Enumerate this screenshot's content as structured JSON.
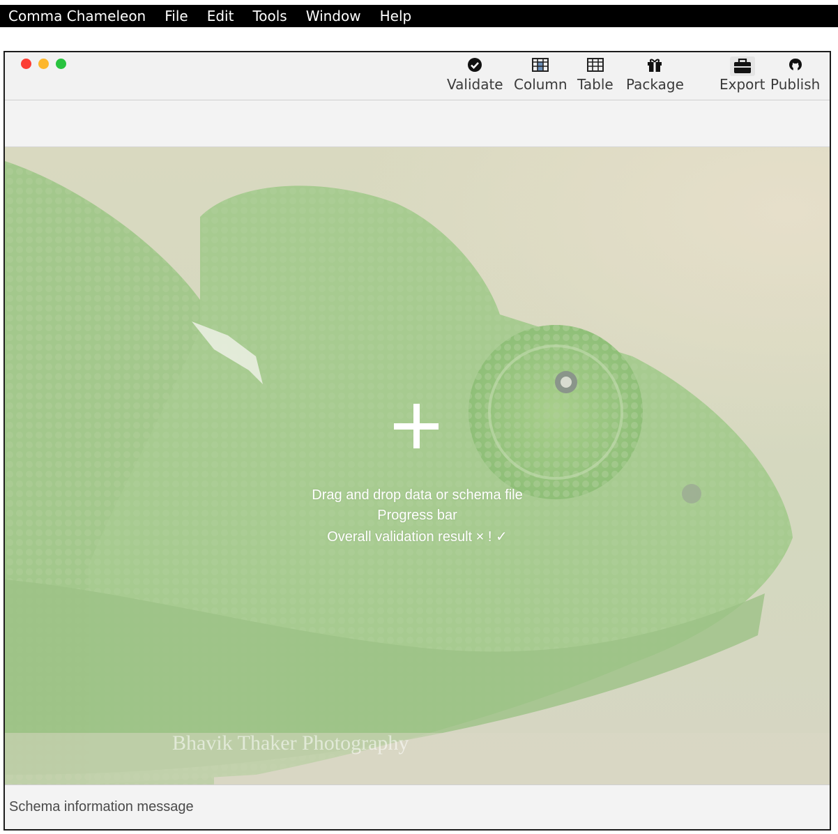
{
  "menubar": {
    "items": [
      "Comma Chameleon",
      "File",
      "Edit",
      "Tools",
      "Window",
      "Help"
    ]
  },
  "toolbar": {
    "validate": {
      "label": "Validate",
      "icon": "check-circle-icon"
    },
    "column": {
      "label": "Column",
      "icon": "column-grid-icon"
    },
    "table": {
      "label": "Table",
      "icon": "table-grid-icon"
    },
    "package": {
      "label": "Package",
      "icon": "gift-icon"
    },
    "export": {
      "label": "Export",
      "icon": "briefcase-icon"
    },
    "publish": {
      "label": "Publish",
      "icon": "github-icon"
    }
  },
  "dropzone": {
    "instruction": "Drag and drop data or schema file",
    "progress": "Progress bar",
    "validation": "Overall validation result × ! ✓"
  },
  "background": {
    "watermark": "Bhavik Thaker Photography"
  },
  "status": {
    "message": "Schema information message"
  },
  "colors": {
    "menubar": "#000000",
    "close": "#fc3e34",
    "minimize": "#fdb72c",
    "zoom": "#29c33f"
  }
}
